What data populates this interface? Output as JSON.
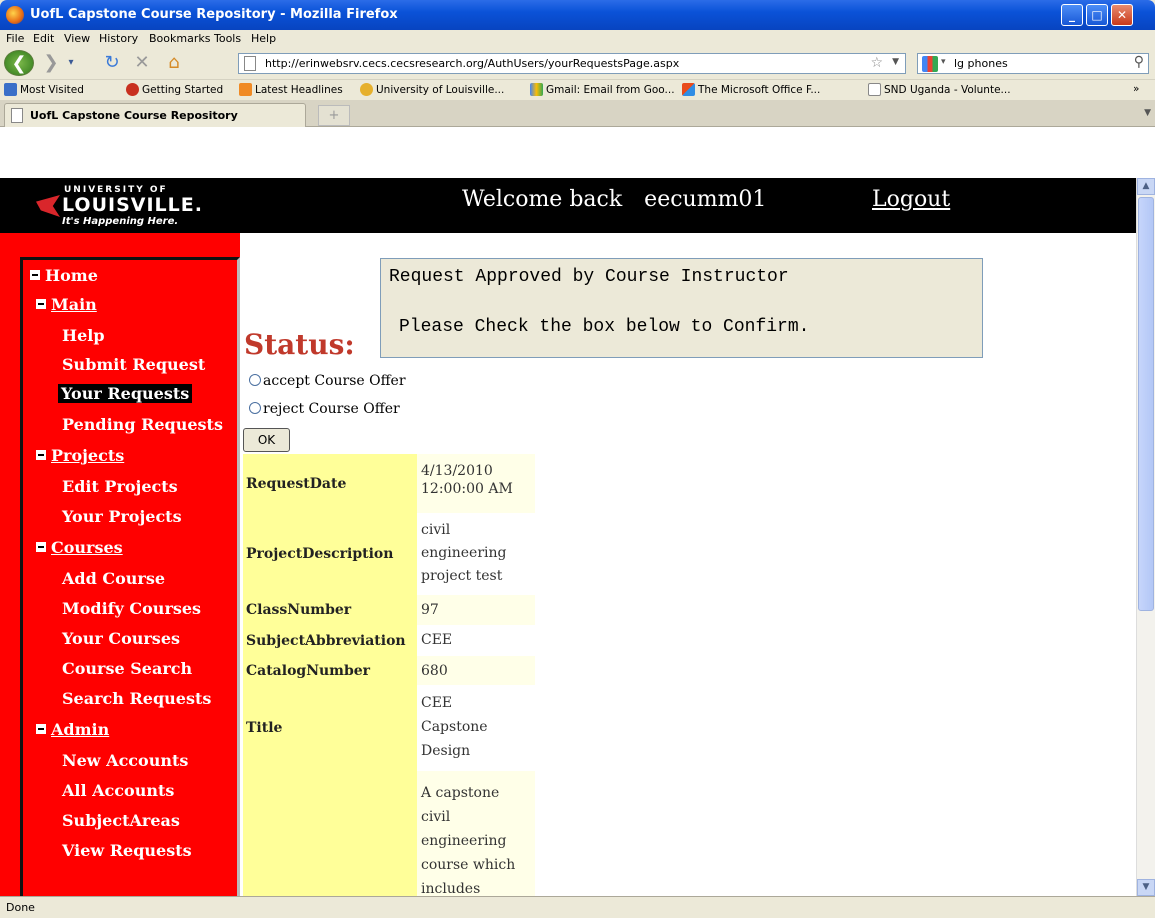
{
  "window": {
    "title": "UofL Capstone Course Repository - Mozilla Firefox"
  },
  "menu": [
    "File",
    "Edit",
    "View",
    "History",
    "Bookmarks",
    "Tools",
    "Help"
  ],
  "nav": {
    "url": "http://erinwebsrv.cecs.cecsresearch.org/AuthUsers/yourRequestsPage.aspx",
    "search_value": "lg phones"
  },
  "bookmarks": [
    "Most Visited",
    "Getting Started",
    "Latest Headlines",
    "University of Louisville...",
    "Gmail: Email from Goo...",
    "The Microsoft Office F...",
    "SND Uganda - Volunte..."
  ],
  "tab": {
    "label": "UofL Capstone Course Repository"
  },
  "header": {
    "logo_top": "UNIVERSITY OF",
    "logo_main": "LOUISVILLE.",
    "logo_sub": "It's Happening Here.",
    "welcome": "Welcome back",
    "username": "eecumm01",
    "logout": "Logout"
  },
  "sidebar": {
    "items": [
      {
        "label": "Home",
        "level": 0,
        "toggle": true,
        "link": false
      },
      {
        "label": "Main",
        "level": 1,
        "toggle": true,
        "link": true
      },
      {
        "label": "Help",
        "level": 2,
        "toggle": false,
        "link": false
      },
      {
        "label": "Submit Request",
        "level": 2,
        "toggle": false,
        "link": false
      },
      {
        "label": "Your Requests",
        "level": 2,
        "toggle": false,
        "link": false,
        "active": true
      },
      {
        "label": "Pending Requests",
        "level": 2,
        "toggle": false,
        "link": false
      },
      {
        "label": "Projects",
        "level": 1,
        "toggle": true,
        "link": true
      },
      {
        "label": "Edit Projects",
        "level": 2,
        "toggle": false,
        "link": false
      },
      {
        "label": "Your Projects",
        "level": 2,
        "toggle": false,
        "link": false
      },
      {
        "label": "Courses",
        "level": 1,
        "toggle": true,
        "link": true
      },
      {
        "label": "Add Course",
        "level": 2,
        "toggle": false,
        "link": false
      },
      {
        "label": "Modify Courses",
        "level": 2,
        "toggle": false,
        "link": false
      },
      {
        "label": "Your Courses",
        "level": 2,
        "toggle": false,
        "link": false
      },
      {
        "label": "Course Search",
        "level": 2,
        "toggle": false,
        "link": false
      },
      {
        "label": "Search Requests",
        "level": 2,
        "toggle": false,
        "link": false
      },
      {
        "label": "Admin",
        "level": 1,
        "toggle": true,
        "link": true
      },
      {
        "label": "New Accounts",
        "level": 2,
        "toggle": false,
        "link": false
      },
      {
        "label": "All Accounts",
        "level": 2,
        "toggle": false,
        "link": false
      },
      {
        "label": "SubjectAreas",
        "level": 2,
        "toggle": false,
        "link": false
      },
      {
        "label": "View Requests",
        "level": 2,
        "toggle": false,
        "link": false
      }
    ]
  },
  "main": {
    "message_line1": "Request Approved by Course Instructor",
    "message_line2": "Please Check the box below to Confirm.",
    "status_label": "Status:",
    "radio_accept": "accept Course Offer",
    "radio_reject": "reject Course Offer",
    "ok_label": "OK",
    "details": [
      {
        "label": "RequestDate",
        "value": "4/13/2010 12:00:00 AM"
      },
      {
        "label": "ProjectDescription",
        "value": "civil engineering project test"
      },
      {
        "label": "ClassNumber",
        "value": "97"
      },
      {
        "label": "SubjectAbbreviation",
        "value": "CEE"
      },
      {
        "label": "CatalogNumber",
        "value": "680"
      },
      {
        "label": "Title",
        "value": "CEE Capstone Design"
      },
      {
        "label": "",
        "value": "A capstone civil engineering course which includes"
      }
    ]
  },
  "status": {
    "text": "Done"
  }
}
